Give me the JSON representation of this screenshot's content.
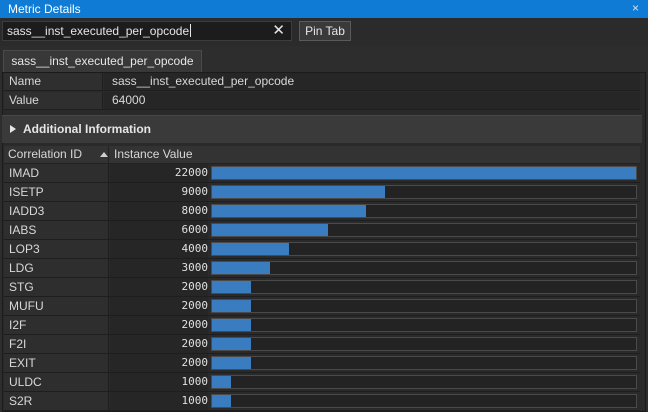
{
  "window": {
    "title": "Metric Details",
    "close_glyph": "×"
  },
  "search": {
    "value": "sass__inst_executed_per_opcode",
    "clear_glyph": "✕"
  },
  "toolbar": {
    "pin_label": "Pin Tab"
  },
  "tab": {
    "label": "sass__inst_executed_per_opcode"
  },
  "properties": [
    {
      "key": "Name",
      "value": "sass__inst_executed_per_opcode"
    },
    {
      "key": "Value",
      "value": "64000"
    }
  ],
  "section": {
    "label": "Additional Information",
    "expanded": false
  },
  "table": {
    "columns": [
      "Correlation ID",
      "Instance Value"
    ],
    "sort": {
      "column": "Correlation ID",
      "direction": "ascending"
    },
    "max_value": 22000,
    "bar_color": "#3a7cc0",
    "rows": [
      {
        "id": "IMAD",
        "value": "22000"
      },
      {
        "id": "ISETP",
        "value": "9000"
      },
      {
        "id": "IADD3",
        "value": "8000"
      },
      {
        "id": "IABS",
        "value": "6000"
      },
      {
        "id": "LOP3",
        "value": "4000"
      },
      {
        "id": "LDG",
        "value": "3000"
      },
      {
        "id": "STG",
        "value": "2000"
      },
      {
        "id": "MUFU",
        "value": "2000"
      },
      {
        "id": "I2F",
        "value": "2000"
      },
      {
        "id": "F2I",
        "value": "2000"
      },
      {
        "id": "EXIT",
        "value": "2000"
      },
      {
        "id": "ULDC",
        "value": "1000"
      },
      {
        "id": "S2R",
        "value": "1000"
      }
    ]
  },
  "colors": {
    "title_bar": "#0f7bd4",
    "background": "#2d2d2d"
  }
}
